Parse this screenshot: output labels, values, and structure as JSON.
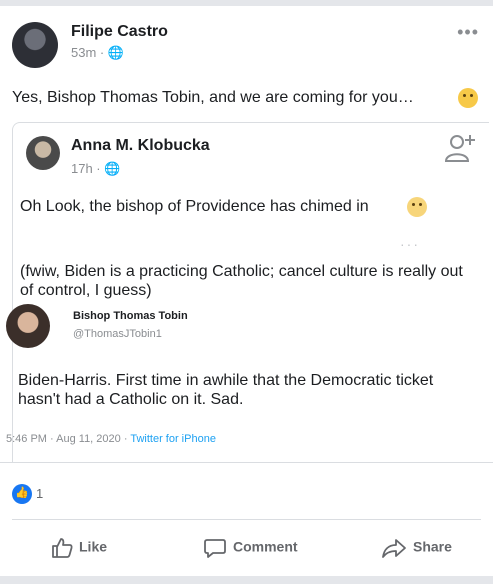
{
  "post": {
    "author": "Filipe Castro",
    "meta": "53m · 🌐",
    "text": "Yes, Bishop Thomas Tobin, and we are coming for you…",
    "more": "•••"
  },
  "shared_post": {
    "author": "Anna M. Klobucka",
    "meta": "17h · 🌐",
    "text": "Oh Look, the bishop of Providence has chimed in",
    "text2": "(fwiw, Biden is a practicing Catholic; cancel culture is really out of control, I guess)"
  },
  "tweet": {
    "author": "Bishop Thomas Tobin",
    "handle": "@ThomasJTobin1",
    "text": "Biden-Harris.  First time in awhile that the Democratic ticket hasn't had a Catholic on it. Sad.",
    "timestamp": "5:46 PM · Aug 11, 2020 · ",
    "source": "Twitter for iPhone"
  },
  "reactions": {
    "count": "1"
  },
  "actions": {
    "like": "Like",
    "comment": "Comment",
    "share": "Share"
  },
  "colors": {
    "accent": "#1877f2",
    "twitter": "#1da1f2"
  }
}
